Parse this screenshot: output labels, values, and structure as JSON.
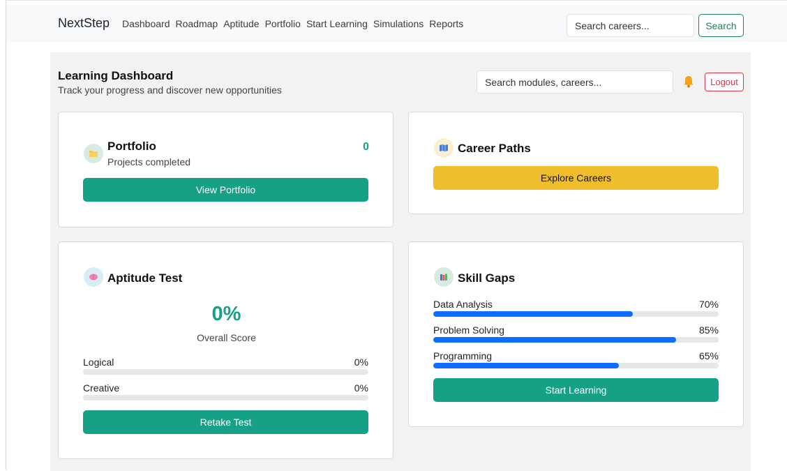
{
  "navbar": {
    "brand": "NextStep",
    "links": [
      "Dashboard",
      "Roadmap",
      "Aptitude",
      "Portfolio",
      "Start Learning",
      "Simulations",
      "Reports"
    ],
    "search_placeholder": "Search careers...",
    "search_button": "Search"
  },
  "header": {
    "title": "Learning Dashboard",
    "subtitle": "Track your progress and discover new opportunities",
    "search_placeholder": "Search modules, careers...",
    "logout_label": "Logout"
  },
  "portfolio": {
    "title": "Portfolio",
    "subtitle": "Projects completed",
    "count": "0",
    "button": "View Portfolio",
    "icon": "folder-icon"
  },
  "career_paths": {
    "title": "Career Paths",
    "button": "Explore Careers",
    "icon": "map-icon"
  },
  "aptitude": {
    "title": "Aptitude Test",
    "score": "0%",
    "score_label": "Overall Score",
    "metrics": [
      {
        "label": "Logical",
        "value_text": "0%",
        "value": 0
      },
      {
        "label": "Creative",
        "value_text": "0%",
        "value": 0
      }
    ],
    "button": "Retake Test",
    "icon": "brain-icon"
  },
  "skill_gaps": {
    "title": "Skill Gaps",
    "skills": [
      {
        "label": "Data Analysis",
        "value_text": "70%",
        "value": 70
      },
      {
        "label": "Problem Solving",
        "value_text": "85%",
        "value": 85
      },
      {
        "label": "Programming",
        "value_text": "65%",
        "value": 65
      }
    ],
    "button": "Start Learning",
    "icon": "books-icon"
  },
  "colors": {
    "accent_teal": "#16a085",
    "accent_yellow": "#f0bd2c",
    "progress_blue": "#0d6efd",
    "success_green": "#198754",
    "danger_red": "#dc3545"
  }
}
